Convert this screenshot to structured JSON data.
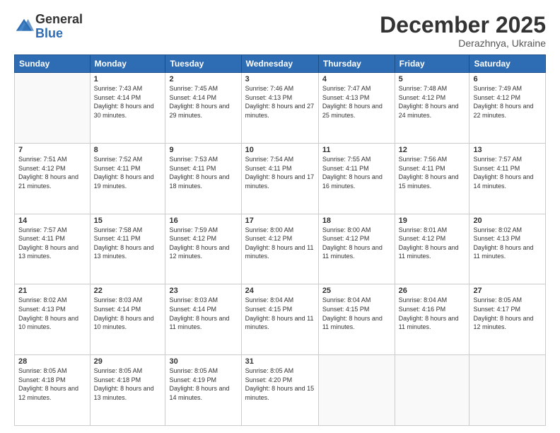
{
  "header": {
    "logo_general": "General",
    "logo_blue": "Blue",
    "month_title": "December 2025",
    "location": "Derazhnya, Ukraine"
  },
  "days_of_week": [
    "Sunday",
    "Monday",
    "Tuesday",
    "Wednesday",
    "Thursday",
    "Friday",
    "Saturday"
  ],
  "weeks": [
    [
      {
        "day": "",
        "sunrise": "",
        "sunset": "",
        "daylight": ""
      },
      {
        "day": "1",
        "sunrise": "Sunrise: 7:43 AM",
        "sunset": "Sunset: 4:14 PM",
        "daylight": "Daylight: 8 hours and 30 minutes."
      },
      {
        "day": "2",
        "sunrise": "Sunrise: 7:45 AM",
        "sunset": "Sunset: 4:14 PM",
        "daylight": "Daylight: 8 hours and 29 minutes."
      },
      {
        "day": "3",
        "sunrise": "Sunrise: 7:46 AM",
        "sunset": "Sunset: 4:13 PM",
        "daylight": "Daylight: 8 hours and 27 minutes."
      },
      {
        "day": "4",
        "sunrise": "Sunrise: 7:47 AM",
        "sunset": "Sunset: 4:13 PM",
        "daylight": "Daylight: 8 hours and 25 minutes."
      },
      {
        "day": "5",
        "sunrise": "Sunrise: 7:48 AM",
        "sunset": "Sunset: 4:12 PM",
        "daylight": "Daylight: 8 hours and 24 minutes."
      },
      {
        "day": "6",
        "sunrise": "Sunrise: 7:49 AM",
        "sunset": "Sunset: 4:12 PM",
        "daylight": "Daylight: 8 hours and 22 minutes."
      }
    ],
    [
      {
        "day": "7",
        "sunrise": "Sunrise: 7:51 AM",
        "sunset": "Sunset: 4:12 PM",
        "daylight": "Daylight: 8 hours and 21 minutes."
      },
      {
        "day": "8",
        "sunrise": "Sunrise: 7:52 AM",
        "sunset": "Sunset: 4:11 PM",
        "daylight": "Daylight: 8 hours and 19 minutes."
      },
      {
        "day": "9",
        "sunrise": "Sunrise: 7:53 AM",
        "sunset": "Sunset: 4:11 PM",
        "daylight": "Daylight: 8 hours and 18 minutes."
      },
      {
        "day": "10",
        "sunrise": "Sunrise: 7:54 AM",
        "sunset": "Sunset: 4:11 PM",
        "daylight": "Daylight: 8 hours and 17 minutes."
      },
      {
        "day": "11",
        "sunrise": "Sunrise: 7:55 AM",
        "sunset": "Sunset: 4:11 PM",
        "daylight": "Daylight: 8 hours and 16 minutes."
      },
      {
        "day": "12",
        "sunrise": "Sunrise: 7:56 AM",
        "sunset": "Sunset: 4:11 PM",
        "daylight": "Daylight: 8 hours and 15 minutes."
      },
      {
        "day": "13",
        "sunrise": "Sunrise: 7:57 AM",
        "sunset": "Sunset: 4:11 PM",
        "daylight": "Daylight: 8 hours and 14 minutes."
      }
    ],
    [
      {
        "day": "14",
        "sunrise": "Sunrise: 7:57 AM",
        "sunset": "Sunset: 4:11 PM",
        "daylight": "Daylight: 8 hours and 13 minutes."
      },
      {
        "day": "15",
        "sunrise": "Sunrise: 7:58 AM",
        "sunset": "Sunset: 4:11 PM",
        "daylight": "Daylight: 8 hours and 13 minutes."
      },
      {
        "day": "16",
        "sunrise": "Sunrise: 7:59 AM",
        "sunset": "Sunset: 4:12 PM",
        "daylight": "Daylight: 8 hours and 12 minutes."
      },
      {
        "day": "17",
        "sunrise": "Sunrise: 8:00 AM",
        "sunset": "Sunset: 4:12 PM",
        "daylight": "Daylight: 8 hours and 11 minutes."
      },
      {
        "day": "18",
        "sunrise": "Sunrise: 8:00 AM",
        "sunset": "Sunset: 4:12 PM",
        "daylight": "Daylight: 8 hours and 11 minutes."
      },
      {
        "day": "19",
        "sunrise": "Sunrise: 8:01 AM",
        "sunset": "Sunset: 4:12 PM",
        "daylight": "Daylight: 8 hours and 11 minutes."
      },
      {
        "day": "20",
        "sunrise": "Sunrise: 8:02 AM",
        "sunset": "Sunset: 4:13 PM",
        "daylight": "Daylight: 8 hours and 11 minutes."
      }
    ],
    [
      {
        "day": "21",
        "sunrise": "Sunrise: 8:02 AM",
        "sunset": "Sunset: 4:13 PM",
        "daylight": "Daylight: 8 hours and 10 minutes."
      },
      {
        "day": "22",
        "sunrise": "Sunrise: 8:03 AM",
        "sunset": "Sunset: 4:14 PM",
        "daylight": "Daylight: 8 hours and 10 minutes."
      },
      {
        "day": "23",
        "sunrise": "Sunrise: 8:03 AM",
        "sunset": "Sunset: 4:14 PM",
        "daylight": "Daylight: 8 hours and 11 minutes."
      },
      {
        "day": "24",
        "sunrise": "Sunrise: 8:04 AM",
        "sunset": "Sunset: 4:15 PM",
        "daylight": "Daylight: 8 hours and 11 minutes."
      },
      {
        "day": "25",
        "sunrise": "Sunrise: 8:04 AM",
        "sunset": "Sunset: 4:15 PM",
        "daylight": "Daylight: 8 hours and 11 minutes."
      },
      {
        "day": "26",
        "sunrise": "Sunrise: 8:04 AM",
        "sunset": "Sunset: 4:16 PM",
        "daylight": "Daylight: 8 hours and 11 minutes."
      },
      {
        "day": "27",
        "sunrise": "Sunrise: 8:05 AM",
        "sunset": "Sunset: 4:17 PM",
        "daylight": "Daylight: 8 hours and 12 minutes."
      }
    ],
    [
      {
        "day": "28",
        "sunrise": "Sunrise: 8:05 AM",
        "sunset": "Sunset: 4:18 PM",
        "daylight": "Daylight: 8 hours and 12 minutes."
      },
      {
        "day": "29",
        "sunrise": "Sunrise: 8:05 AM",
        "sunset": "Sunset: 4:18 PM",
        "daylight": "Daylight: 8 hours and 13 minutes."
      },
      {
        "day": "30",
        "sunrise": "Sunrise: 8:05 AM",
        "sunset": "Sunset: 4:19 PM",
        "daylight": "Daylight: 8 hours and 14 minutes."
      },
      {
        "day": "31",
        "sunrise": "Sunrise: 8:05 AM",
        "sunset": "Sunset: 4:20 PM",
        "daylight": "Daylight: 8 hours and 15 minutes."
      },
      {
        "day": "",
        "sunrise": "",
        "sunset": "",
        "daylight": ""
      },
      {
        "day": "",
        "sunrise": "",
        "sunset": "",
        "daylight": ""
      },
      {
        "day": "",
        "sunrise": "",
        "sunset": "",
        "daylight": ""
      }
    ]
  ]
}
